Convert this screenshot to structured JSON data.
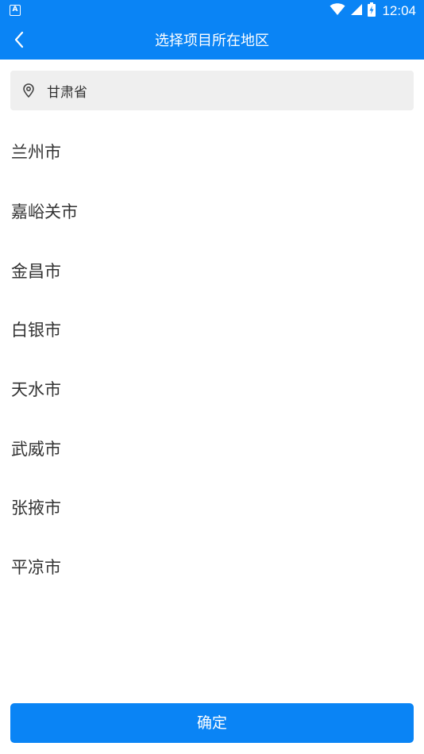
{
  "status_bar": {
    "app_icon_letter": "A",
    "time": "12:04",
    "icons": [
      "wifi-icon",
      "cell-signal-icon",
      "battery-charging-icon"
    ]
  },
  "header": {
    "title": "选择项目所在地区",
    "back_icon": "chevron-left-icon"
  },
  "province": {
    "icon": "location-pin-icon",
    "label": "甘肃省"
  },
  "cities": [
    {
      "label": "兰州市"
    },
    {
      "label": "嘉峪关市"
    },
    {
      "label": "金昌市"
    },
    {
      "label": "白银市"
    },
    {
      "label": "天水市"
    },
    {
      "label": "武威市"
    },
    {
      "label": "张掖市"
    },
    {
      "label": "平凉市"
    }
  ],
  "footer": {
    "confirm_label": "确定"
  },
  "colors": {
    "primary": "#0a84f5",
    "province_bg": "#efefef",
    "text": "#333333"
  }
}
